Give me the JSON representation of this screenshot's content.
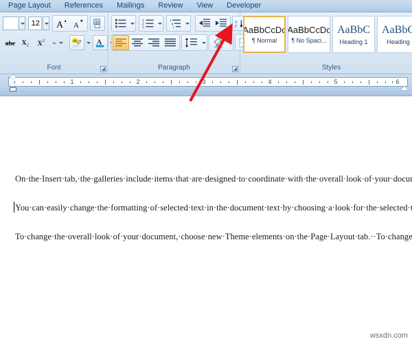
{
  "tabs": [
    {
      "label": "Page Layout"
    },
    {
      "label": "References"
    },
    {
      "label": "Mailings"
    },
    {
      "label": "Review"
    },
    {
      "label": "View"
    },
    {
      "label": "Developer"
    }
  ],
  "ribbon": {
    "font_group": {
      "label": "Font",
      "font_size_value": "12",
      "buttons": [
        {
          "name": "grow-font",
          "glyph": "A"
        },
        {
          "name": "shrink-font",
          "glyph": "A"
        },
        {
          "name": "clear-formatting",
          "glyph": "A"
        },
        {
          "name": "strikethrough",
          "glyph": "abc"
        },
        {
          "name": "subscript",
          "glyph": "X"
        },
        {
          "name": "superscript",
          "glyph": "X"
        },
        {
          "name": "change-case",
          "glyph": "Aa"
        },
        {
          "name": "text-highlight-color",
          "glyph": "ab"
        },
        {
          "name": "font-color",
          "glyph": "A"
        }
      ],
      "launcher": "↘"
    },
    "paragraph_group": {
      "label": "Paragraph",
      "buttons": [
        {
          "name": "bullets"
        },
        {
          "name": "numbering"
        },
        {
          "name": "multilevel-list"
        },
        {
          "name": "decrease-indent"
        },
        {
          "name": "increase-indent"
        },
        {
          "name": "sort"
        },
        {
          "name": "show-hide-marks",
          "glyph": "¶",
          "active": true
        },
        {
          "name": "align-left",
          "active": true
        },
        {
          "name": "align-center"
        },
        {
          "name": "align-right"
        },
        {
          "name": "justify"
        },
        {
          "name": "line-spacing"
        },
        {
          "name": "shading"
        },
        {
          "name": "borders"
        }
      ],
      "sort_top": "A",
      "sort_bottom": "Z",
      "launcher": "↘"
    },
    "styles_group": {
      "label": "Styles",
      "items": [
        {
          "sample": "AaBbCcDc",
          "name": "¶ Normal",
          "selected": true,
          "kind": "sans"
        },
        {
          "sample": "AaBbCcDc",
          "name": "¶ No Spaci...",
          "selected": false,
          "kind": "sans"
        },
        {
          "sample": "AaBbC",
          "name": "Heading 1",
          "selected": false,
          "kind": "h1"
        },
        {
          "sample": "AaBbC",
          "name": "Heading",
          "selected": false,
          "kind": "h1"
        }
      ]
    }
  },
  "ruler": {
    "numbers": [
      "1",
      "2",
      "3",
      "4",
      "5",
      "6"
    ]
  },
  "document": {
    "paragraphs": [
      "On·the·Insert·tab,·the·galleries·include·items·that·are·designed·to·coordinate·with·the·overall·look·of·your·document.··You·can·use·these·galleries·to·insert·tables,·headers,·footers,·lists,·cover·pages,·and·other·document·building·blocks.··When·you·create·pictures,·charts,·or·diagrams,·they·also·coordinate·with·your·current·document·look.¶",
      "You·can·easily·change·the·formatting·of·selected·text·in·the·document·text·by·choosing·a·look·for·the·selected·text·from·the·Quick·Styles·gallery·on·the·Home·tab.··You·can·also·format·text·directly·by·using·the·other·controls·on·the·Home·tab.··Most·controls·offer·a·choice·of·using·the·look·from·the·current·theme·or·using·a·format·that·you·specify·directly.¶",
      "To·change·the·overall·look·of·your·document,·choose·new·Theme·elements·on·the·Page·Layout·tab.··To·change·the·looks·available·in·the·Quick·Style·gallery,·use·the·Change·Current·Quick·Style·"
    ]
  },
  "watermark": "wsxdn.com",
  "colors": {
    "accent_orange": "#fbc96a",
    "arrow_red": "#e8141e",
    "tab_text": "#16446e",
    "ribbon_bg": "#dfeaf6"
  }
}
